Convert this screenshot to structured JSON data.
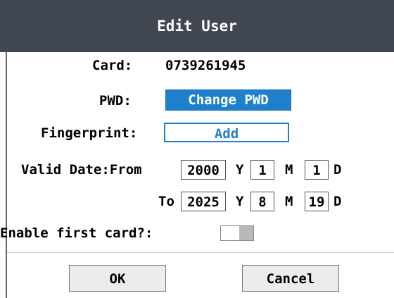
{
  "dialog": {
    "title": "Edit User",
    "card_label": "Card:",
    "card_value": "0739261945",
    "pwd_label": "PWD:",
    "change_pwd_label": "Change PWD",
    "fingerprint_label": "Fingerprint:",
    "add_label": "Add",
    "valid_date_label": "Valid Date:From",
    "from": {
      "year": "2000",
      "month": "1",
      "day": "1"
    },
    "to_label": "To",
    "to": {
      "year": "2025",
      "month": "8",
      "day": "19"
    },
    "unit_year": "Y",
    "unit_month": "M",
    "unit_day": "D",
    "enable_first_card_label": "Enable first card?:",
    "enable_first_card_on": false,
    "ok_label": "OK",
    "cancel_label": "Cancel"
  },
  "colors": {
    "titlebar": "#414750",
    "accent": "#1e7fcd"
  }
}
